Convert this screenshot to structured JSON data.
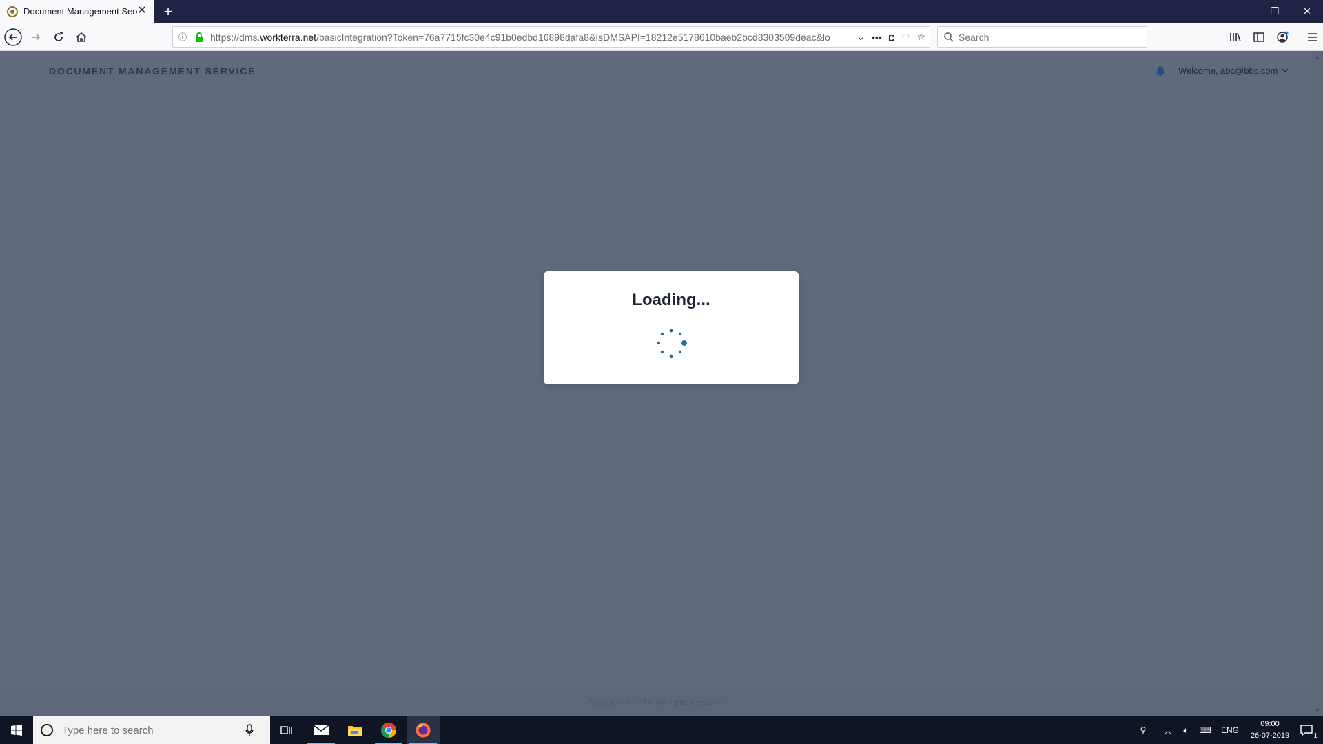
{
  "browser": {
    "tab_title": "Document Management Servic",
    "new_tab_label": "+",
    "url_prefix": "https://dms.",
    "url_host": "workterra.net",
    "url_rest": "/basicIntegration?Token=76a7715fc30e4c91b0edbd16898dafa8&IsDMSAPI=18212e5178610baeb2bcd8303509deac&lo",
    "search_placeholder": "Search"
  },
  "app": {
    "brand": "DOCUMENT MANAGEMENT SERVICE",
    "welcome": "Welcome, abc@bbc.com",
    "copyright": "Copyright © 2019. All rights reserved."
  },
  "modal": {
    "title": "Loading..."
  },
  "taskbar": {
    "search_placeholder": "Type here to search",
    "language": "ENG",
    "time": "09:00",
    "date": "26-07-2019",
    "notification_count": "1"
  },
  "colors": {
    "page_overlay": "#5f6a7c",
    "spinner": "#1f6fa8",
    "firefox_titlebar": "#1f2445"
  }
}
